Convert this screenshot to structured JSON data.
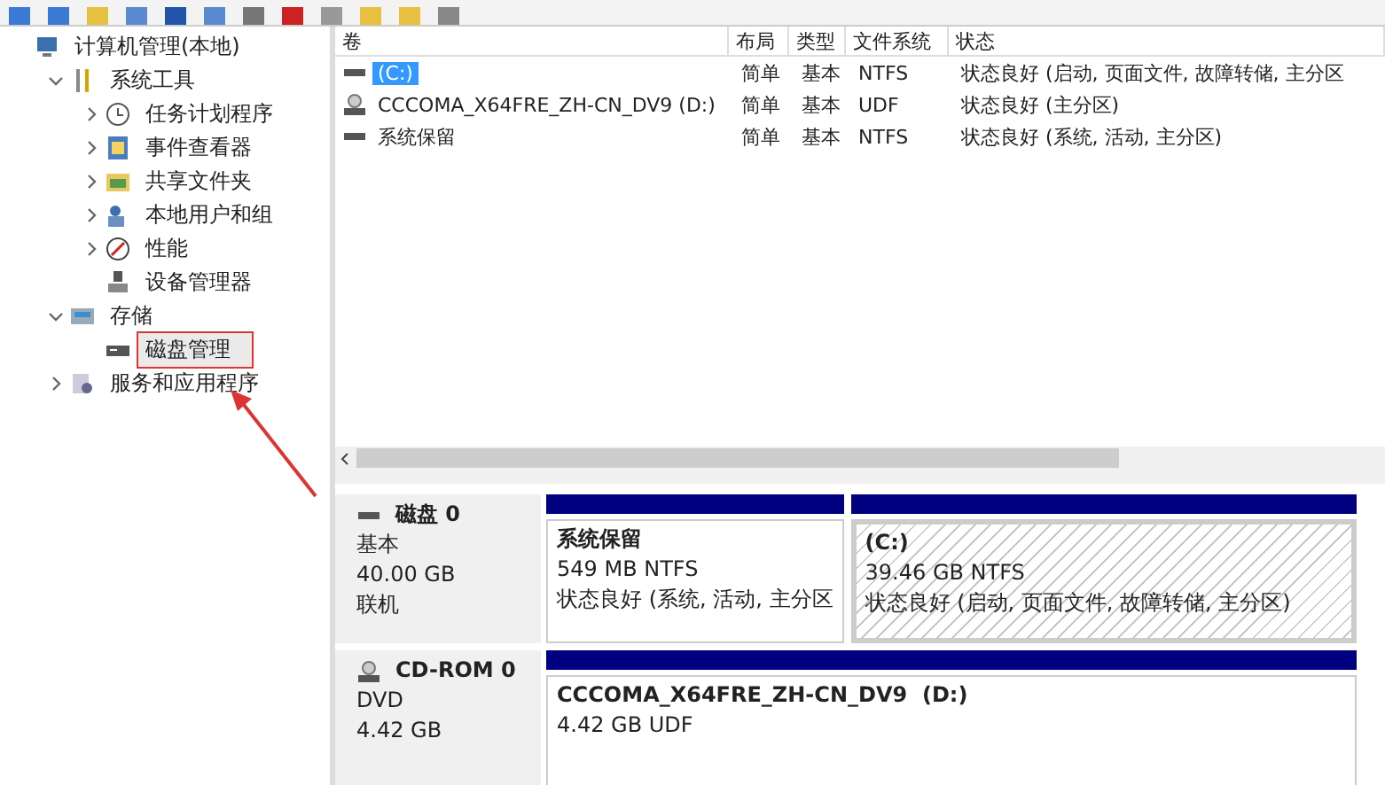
{
  "tree": [
    {
      "label": "计算机管理(本地)",
      "children": [
        {
          "label": "系统工具",
          "expanded": true,
          "children": [
            {
              "label": "任务计划程序",
              "expanded": false,
              "selected": false
            },
            {
              "label": "事件查看器",
              "expanded": false,
              "selected": false
            },
            {
              "label": "共享文件夹",
              "expanded": false,
              "selected": false
            },
            {
              "label": "本地用户和组",
              "expanded": false,
              "selected": false
            },
            {
              "label": "性能",
              "expanded": false,
              "selected": false
            },
            {
              "label": "设备管理器",
              "selected": false
            }
          ]
        },
        {
          "label": "存储",
          "expanded": true,
          "children": [
            {
              "label": "磁盘管理",
              "selected": true
            }
          ]
        },
        {
          "label": "服务和应用程序",
          "expanded": false
        }
      ]
    }
  ],
  "volumes": {
    "columns": [
      "卷",
      "布局",
      "类型",
      "文件系统",
      "状态"
    ],
    "rows": [
      {
        "kind": "disk",
        "selected": true,
        "cells": [
          "(C:)",
          "简单",
          "基本",
          "NTFS",
          "状态良好 (启动, 页面文件, 故障转储, 主分区"
        ]
      },
      {
        "kind": "cd",
        "selected": false,
        "cells": [
          "CCCOMA_X64FRE_ZH-CN_DV9 (D:)",
          "简单",
          "基本",
          "UDF",
          "状态良好 (主分区)"
        ]
      },
      {
        "kind": "disk",
        "selected": false,
        "cells": [
          "系统保留",
          "简单",
          "基本",
          "NTFS",
          "状态良好 (系统, 活动, 主分区)"
        ]
      }
    ]
  },
  "disks": [
    {
      "kind": "disk",
      "name": "磁盘 0",
      "lines": [
        "基本",
        "40.00 GB",
        "联机"
      ],
      "partitions": [
        {
          "name": "系统保留",
          "lines": [
            "549 MB NTFS",
            "状态良好 (系统, 活动, 主分区"
          ],
          "selected": false
        },
        {
          "name": "(C:)",
          "lines": [
            "39.46 GB NTFS",
            "状态良好 (启动, 页面文件, 故障转储, 主分区)"
          ],
          "selected": true
        }
      ]
    },
    {
      "kind": "cd",
      "name": "CD-ROM 0",
      "lines": [
        "DVD",
        "4.42 GB"
      ],
      "partitions": [
        {
          "name": "CCCOMA_X64FRE_ZH-CN_DV9  (D:)",
          "lines": [
            "4.42 GB UDF"
          ],
          "selected": false
        }
      ]
    }
  ]
}
